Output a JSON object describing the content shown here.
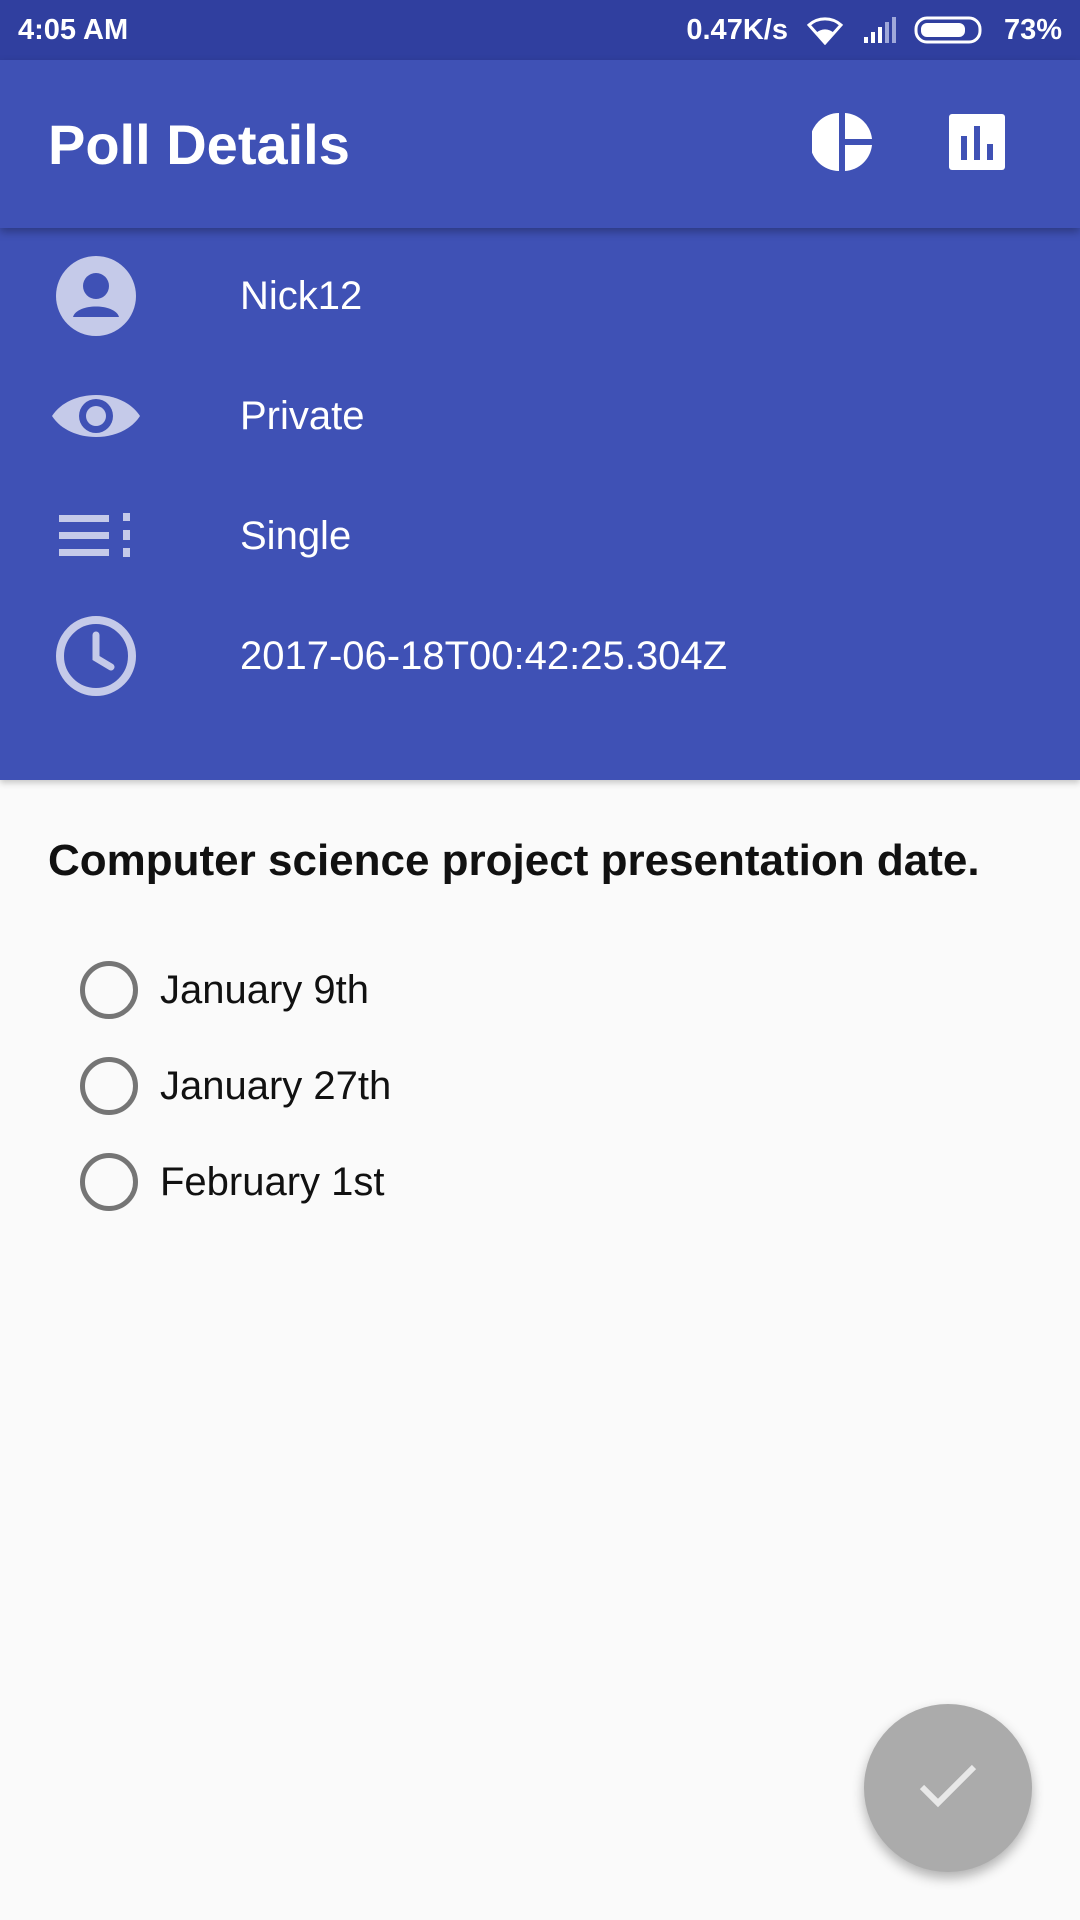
{
  "status_bar": {
    "time": "4:05 AM",
    "network_speed": "0.47K/s",
    "battery": "73%",
    "icons": [
      "wifi-icon",
      "signal-icon",
      "battery-icon"
    ]
  },
  "app_bar": {
    "title": "Poll Details",
    "actions": [
      {
        "name": "pie-chart-icon",
        "label": "Pie chart"
      },
      {
        "name": "bar-chart-icon",
        "label": "Bar chart"
      }
    ]
  },
  "poll_info": {
    "author": "Nick12",
    "visibility": "Private",
    "type": "Single",
    "created": "2017-06-18T00:42:25.304Z",
    "icons": [
      "account-icon",
      "eye-icon",
      "list-icon",
      "clock-icon"
    ]
  },
  "poll": {
    "question": "Computer science project presentation date.",
    "options": [
      {
        "label": "January 9th",
        "selected": false
      },
      {
        "label": "January 27th",
        "selected": false
      },
      {
        "label": "February 1st",
        "selected": false
      }
    ]
  },
  "fab": {
    "icon": "check-icon"
  },
  "colors": {
    "primary": "#3f51b5",
    "primary_dark": "#303f9f",
    "fab_disabled": "#ababab",
    "radio": "#757575"
  }
}
